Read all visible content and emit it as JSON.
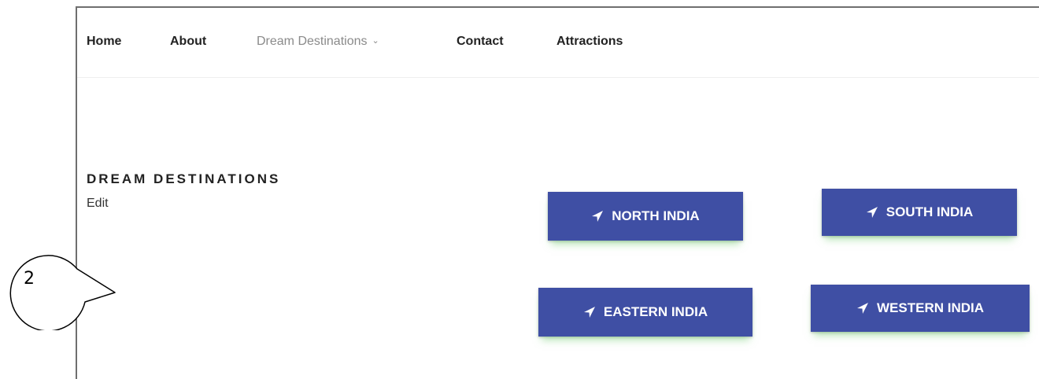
{
  "nav": {
    "items": [
      {
        "label": "Home"
      },
      {
        "label": "About"
      },
      {
        "label": "Dream Destinations",
        "has_dropdown": true
      },
      {
        "label": "Contact"
      },
      {
        "label": "Attractions"
      }
    ],
    "dropdown_icon": "chevron-down-icon"
  },
  "page": {
    "heading": "DREAM DESTINATIONS",
    "edit_label": "Edit"
  },
  "buttons": {
    "north": "NORTH INDIA",
    "south": "SOUTH INDIA",
    "eastern": "EASTERN INDIA",
    "western": "WESTERN INDIA",
    "icon": "location-arrow-icon",
    "color": "#3f4fa4"
  },
  "callout": {
    "label": "2"
  }
}
